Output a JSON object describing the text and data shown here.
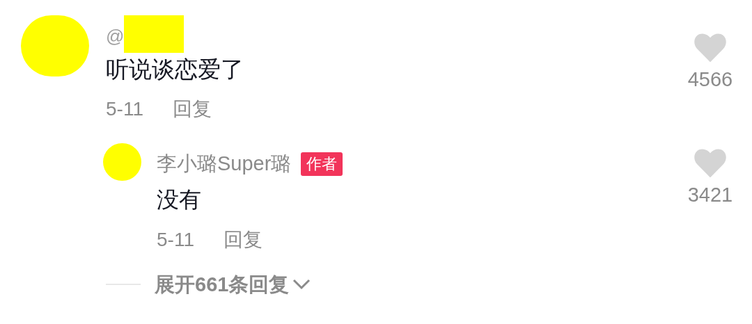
{
  "comment": {
    "author": "@",
    "text": "听说谈恋爱了",
    "date": "5-11",
    "reply_label": "回复",
    "likes": "4566",
    "liked": false
  },
  "reply": {
    "author": "李小璐Super璐",
    "badge": "作者",
    "text": "没有",
    "date": "5-11",
    "reply_label": "回复",
    "likes": "3421",
    "liked": false
  },
  "expand": {
    "label": "展开661条回复"
  }
}
